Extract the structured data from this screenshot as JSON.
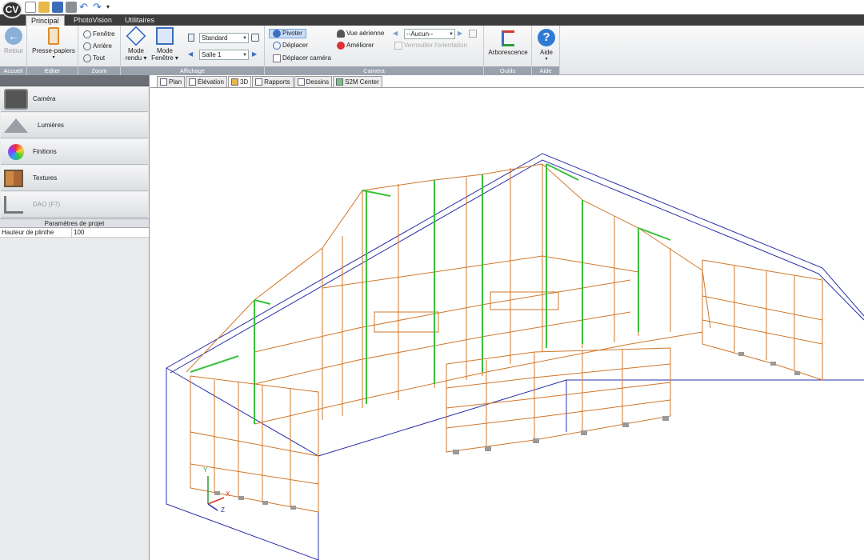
{
  "app": {
    "logo_text": "CV"
  },
  "ribbon_tabs": [
    {
      "label": "Principal"
    },
    {
      "label": "PhotoVision"
    },
    {
      "label": "Utilitaires"
    }
  ],
  "groups": {
    "accueil": {
      "label": "Accueil",
      "retour": "Retour"
    },
    "editer": {
      "label": "Editer",
      "presse": "Presse-papiers"
    },
    "zoom": {
      "label": "Zoom",
      "fenetre": "Fenêtre",
      "arriere": "Arrière",
      "tout": "Tout"
    },
    "affichage": {
      "label": "Affichage",
      "mode_rendu_1": "Mode",
      "mode_rendu_2": "rendu",
      "mode_fenetre_1": "Mode",
      "mode_fenetre_2": "Fenêtre",
      "combo_style": "Standard",
      "combo_room": "Salle 1"
    },
    "camera": {
      "label": "Camera",
      "pivoter": "Pivoter",
      "deplacer": "Déplacer",
      "deplacer_camera": "Déplacer caméra",
      "vue_aerienne": "Vue aérienne",
      "ameliorer": "Améliorer",
      "combo_view": "--Aucun--",
      "verrouiller": "Verrouiller l'orientation"
    },
    "outils": {
      "label": "Outils",
      "arborescence": "Arborescence"
    },
    "aide": {
      "label": "Aide",
      "aide": "Aide"
    }
  },
  "left_panel": {
    "items": [
      {
        "label": "Caméra",
        "icon": "camera-icon"
      },
      {
        "label": "Lumières",
        "icon": "lamp-icon"
      },
      {
        "label": "Finitions",
        "icon": "color-wheel-icon"
      },
      {
        "label": "Textures",
        "icon": "textures-icon"
      },
      {
        "label": "DAO (F7)",
        "icon": "cad-ruler-icon"
      }
    ],
    "params_title": "Paramètres de projet",
    "params": [
      {
        "name": "Hauteur de plinthe",
        "value": "100"
      }
    ]
  },
  "doc_tabs": [
    {
      "label": "Plan"
    },
    {
      "label": "Élévation"
    },
    {
      "label": "3D"
    },
    {
      "label": "Rapports"
    },
    {
      "label": "Dessins"
    },
    {
      "label": "S2M Center"
    }
  ],
  "axes": {
    "y": "Y",
    "x": "X",
    "z": "Z"
  },
  "colors": {
    "accent_green": "#37c23c",
    "wire_orange": "#d0772a",
    "wire_blue": "#2a2fa8"
  }
}
